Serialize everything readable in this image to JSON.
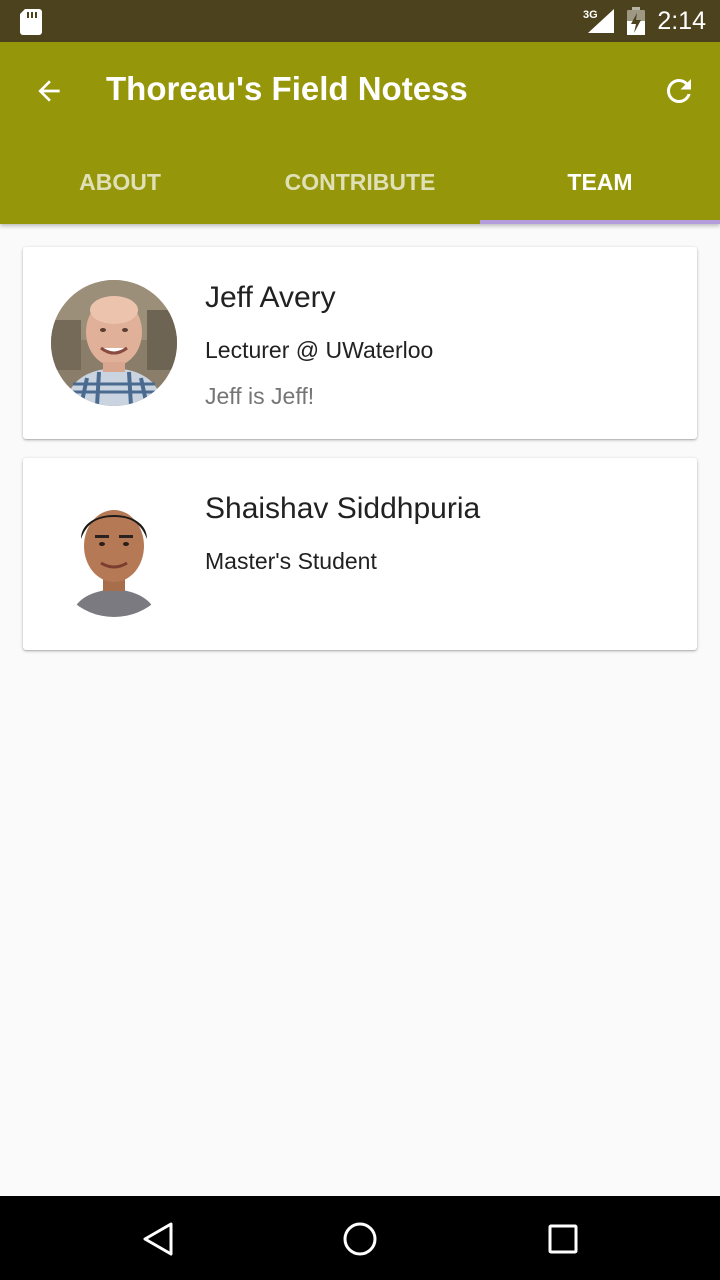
{
  "status_bar": {
    "network": "3G",
    "time": "2:14",
    "icons": [
      "sd-card-icon",
      "signal-icon",
      "battery-charging-icon"
    ]
  },
  "app_bar": {
    "title": "Thoreau's Field Notess",
    "back_icon": "arrow-back-icon",
    "refresh_icon": "refresh-icon",
    "color": "#96960b"
  },
  "tabs": [
    {
      "label": "ABOUT",
      "active": false
    },
    {
      "label": "CONTRIBUTE",
      "active": false
    },
    {
      "label": "TEAM",
      "active": true
    }
  ],
  "team": [
    {
      "name": "Jeff Avery",
      "role": "Lecturer @ UWaterloo",
      "bio": "Jeff is Jeff!"
    },
    {
      "name": "Shaishav Siddhpuria",
      "role": "Master's Student",
      "bio": ""
    }
  ],
  "nav_bar": {
    "icons": [
      "nav-back-icon",
      "nav-home-icon",
      "nav-recents-icon"
    ]
  },
  "colors": {
    "status_bar": "#4d421e",
    "app_bar": "#96960b",
    "tab_indicator": "#b39ddb",
    "background": "#fafafa"
  }
}
